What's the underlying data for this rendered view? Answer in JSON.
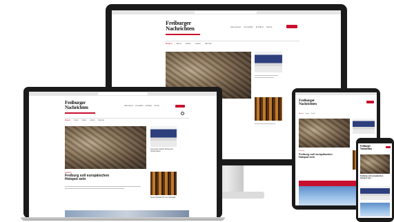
{
  "site": {
    "brand_line1": "Freiburger",
    "brand_line2": "Nachrichten",
    "nav_items": [
      "Region",
      "Sport",
      "Kultur",
      "Leben",
      "Service"
    ],
    "top_links": [
      "Abonnieren",
      "Anmelden",
      "E-Paper",
      "Suche"
    ],
    "cta_label": "Abo",
    "article_kicker": "Freiburg",
    "article_headline": "Freiburg soll europäischen Hotspot sein",
    "side_caption_1": "Feuerwehr trainiert Rettung am Schauinsland",
    "side_caption_2": "Neues Holzdach für den Sportpark"
  },
  "colors": {
    "accent": "#c8102e",
    "device_bezel": "#1a1a1a",
    "stand": "#d9d9d9"
  },
  "devices": [
    "desktop-monitor",
    "laptop",
    "tablet",
    "smartphone"
  ]
}
